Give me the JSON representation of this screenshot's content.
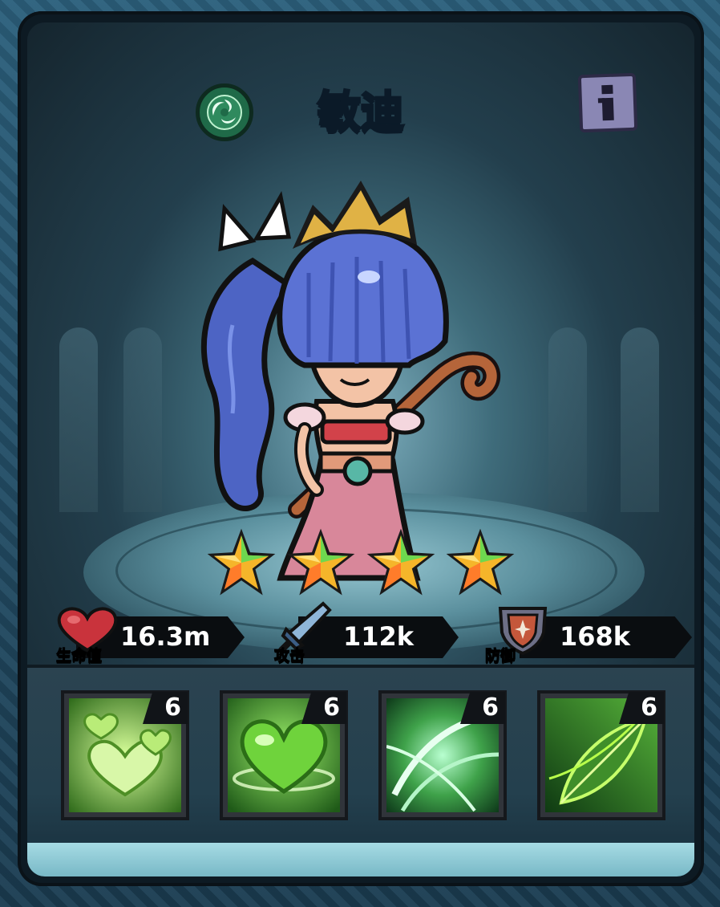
{
  "hero": {
    "name": "敏迪",
    "element_icon": "wind-swirl-icon",
    "info_icon": "info-icon",
    "star_count": 4,
    "stars_max": 4
  },
  "stats": [
    {
      "key": "hp",
      "label": "生命值",
      "value": "16.3m",
      "icon": "heart-icon"
    },
    {
      "key": "attack",
      "label": "攻击",
      "value": "112k",
      "icon": "sword-icon"
    },
    {
      "key": "defense",
      "label": "防御",
      "value": "168k",
      "icon": "shield-icon"
    }
  ],
  "skills": [
    {
      "level": "6",
      "icon": "hearts-burst-skill-icon"
    },
    {
      "level": "6",
      "icon": "heart-heal-skill-icon"
    },
    {
      "level": "6",
      "icon": "green-slash-skill-icon"
    },
    {
      "level": "6",
      "icon": "leaf-blade-skill-icon"
    }
  ],
  "colors": {
    "title": "#3ea2e0",
    "skill_green": "#5fc93a",
    "star_gold": "#f5b52a",
    "star_green": "#6ed84f"
  }
}
